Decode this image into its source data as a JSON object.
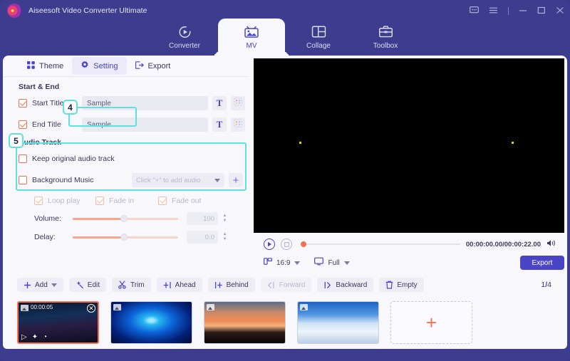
{
  "window": {
    "app_title": "Aiseesoft Video Converter Ultimate",
    "logo_icon": "aiseesoft-logo-icon",
    "controls": [
      {
        "name": "feedback-icon",
        "glyph": "⌨"
      },
      {
        "name": "menu-icon",
        "glyph": "≡"
      },
      {
        "name": "minimize-icon",
        "glyph": "—"
      },
      {
        "name": "maximize-icon",
        "glyph": "□"
      },
      {
        "name": "close-icon",
        "glyph": "✕"
      }
    ]
  },
  "mainnav": {
    "items": [
      {
        "label": "Converter",
        "icon": "converter-icon",
        "active": false
      },
      {
        "label": "MV",
        "icon": "mv-icon",
        "active": true
      },
      {
        "label": "Collage",
        "icon": "collage-icon",
        "active": false
      },
      {
        "label": "Toolbox",
        "icon": "toolbox-icon",
        "active": false
      }
    ]
  },
  "subtabs": {
    "items": [
      {
        "label": "Theme",
        "icon": "theme-grid-icon",
        "active": false
      },
      {
        "label": "Setting",
        "icon": "gear-icon",
        "active": true
      },
      {
        "label": "Export",
        "icon": "export-icon",
        "active": false
      }
    ]
  },
  "settings": {
    "start_end": {
      "section_label": "Start & End",
      "start_title": {
        "label": "Start Title",
        "checked": true,
        "value": "Sample",
        "text_icon": "T",
        "style_icon": "color-palette-icon"
      },
      "end_title": {
        "label": "End Title",
        "checked": true,
        "value": "Sample",
        "text_icon": "T",
        "style_icon": "color-palette-icon"
      }
    },
    "audio_track": {
      "section_label": "Audio Track",
      "keep_original": {
        "label": "Keep original audio track",
        "checked": false
      },
      "background_music": {
        "label": "Background Music",
        "checked": false,
        "select_placeholder": "Click \"+\" to add audio",
        "add_label": "+"
      },
      "toggles": [
        {
          "label": "Loop play",
          "checked": true,
          "disabled": true
        },
        {
          "label": "Fade in",
          "checked": true,
          "disabled": true
        },
        {
          "label": "Fade out",
          "checked": true,
          "disabled": true
        }
      ],
      "volume": {
        "label": "Volume:",
        "value": "100",
        "percent": 50
      },
      "delay": {
        "label": "Delay:",
        "value": "0.0",
        "percent": 50
      }
    }
  },
  "preview": {
    "play_icon": "play-icon",
    "stop_icon": "stop-icon",
    "time_display": "00:00:00.00/00:00:22.00",
    "volume_icon": "volume-icon",
    "aspect_icon": "aspect-ratio-icon",
    "aspect_value": "16:9",
    "screen_icon": "screen-icon",
    "screen_value": "Full",
    "export_label": "Export",
    "seek_percent": 0
  },
  "toolbar": {
    "buttons": [
      {
        "label": "Add",
        "icon": "plus-icon",
        "has_caret": true,
        "disabled": false
      },
      {
        "label": "Edit",
        "icon": "magic-wand-icon",
        "has_caret": false,
        "disabled": false
      },
      {
        "label": "Trim",
        "icon": "scissors-icon",
        "has_caret": false,
        "disabled": false
      },
      {
        "label": "Ahead",
        "icon": "insert-ahead-icon",
        "has_caret": false,
        "disabled": false
      },
      {
        "label": "Behind",
        "icon": "insert-behind-icon",
        "has_caret": false,
        "disabled": false
      },
      {
        "label": "Forward",
        "icon": "move-forward-icon",
        "has_caret": false,
        "disabled": true
      },
      {
        "label": "Backward",
        "icon": "move-backward-icon",
        "has_caret": false,
        "disabled": false
      },
      {
        "label": "Empty",
        "icon": "trash-icon",
        "has_caret": false,
        "disabled": false
      }
    ],
    "page_current": "1",
    "page_separator": "/",
    "page_total": "4"
  },
  "thumbnails": {
    "items": [
      {
        "name": "thumb-city-night",
        "duration": "00:00:05",
        "selected": true,
        "theme": "t-city",
        "tools": [
          "play-icon",
          "magic-wand-icon",
          "clock-icon"
        ],
        "close_icon": "✕"
      },
      {
        "name": "thumb-blue-abstract",
        "duration": "",
        "selected": false,
        "theme": "t-blue",
        "tools": [],
        "close_icon": ""
      },
      {
        "name": "thumb-sunset",
        "duration": "",
        "selected": false,
        "theme": "t-sunset",
        "tools": [],
        "close_icon": ""
      },
      {
        "name": "thumb-mountain",
        "duration": "",
        "selected": false,
        "theme": "t-mount",
        "tools": [],
        "close_icon": ""
      }
    ],
    "add_tile_label": "+"
  },
  "callouts": {
    "step4": "4",
    "step5": "5",
    "highlight_color": "#5EE0E0"
  },
  "colors": {
    "brand_purple": "#3D3C8E",
    "accent_indigo": "#4A45C4",
    "accent_orange": "#F4714E",
    "panel_bg": "#F7F7FC",
    "highlight_cyan": "#5EE0E0"
  }
}
